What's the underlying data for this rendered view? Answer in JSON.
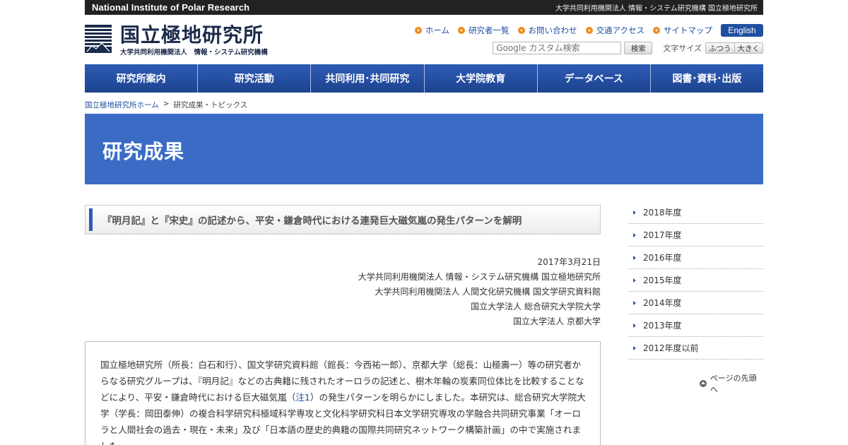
{
  "topbar": {
    "en_name": "National Institute of Polar Research",
    "jp_affiliation": "大学共同利用機関法人 情報・システム研究機構 国立極地研究所"
  },
  "logo": {
    "name": "国立極地研究所",
    "sub": "大学共同利用機関法人　情報・システム研究機構"
  },
  "utility_links": [
    {
      "label": "ホーム"
    },
    {
      "label": "研究者一覧"
    },
    {
      "label": "お問い合わせ"
    },
    {
      "label": "交通アクセス"
    },
    {
      "label": "サイトマップ"
    }
  ],
  "english_label": "English",
  "search": {
    "placeholder": "Google カスタム検索",
    "button": "検索"
  },
  "fontsize": {
    "label": "文字サイズ",
    "normal": "ふつう",
    "large": "大きく"
  },
  "gnav": [
    {
      "label": "研究所案内"
    },
    {
      "label": "研究活動"
    },
    {
      "label": "共同利用･共同研究"
    },
    {
      "label": "大学院教育"
    },
    {
      "label": "データベース"
    },
    {
      "label": "図書･資料･出版"
    }
  ],
  "breadcrumb": {
    "home": "国立極地研究所ホーム",
    "sep": ">",
    "current": "研究成果・トピックス"
  },
  "banner_title": "研究成果",
  "article": {
    "title": "『明月記』と『宋史』の記述から、平安・鎌倉時代における連発巨大磁気嵐の発生パターンを解明",
    "date": "2017年3月21日",
    "orgs": [
      "大学共同利用機関法人 情報・システム研究機構 国立極地研究所",
      "大学共同利用機関法人 人間文化研究機構 国文学研究資料館",
      "国立大学法人 総合研究大学院大学",
      "国立大学法人 京都大学"
    ],
    "body_before": "国立極地研究所（所長：白石和行）、国文学研究資料館（館長：今西祐一郎）、京都大学（総長：山極壽一）等の研究者からなる研究グループは、『明月記』などの古典籍に残されたオーロラの記述と、樹木年輪の炭素同位体比を比較することなどにより、平安・鎌倉時代における巨大磁気嵐（",
    "note_link": "注1",
    "body_after": "）の発生パターンを明らかにしました。本研究は、総合研究大学院大学（学長：岡田泰伸）の複合科学研究科極域科学専攻と文化科学研究科日本文学研究専攻の学融合共同研究事業「オーロラと人間社会の過去・現在・未来」及び「日本語の歴史的典籍の国際共同研究ネットワーク構築計画」の中で実施されました。"
  },
  "sidebar": {
    "years": [
      {
        "label": "2018年度"
      },
      {
        "label": "2017年度"
      },
      {
        "label": "2016年度"
      },
      {
        "label": "2015年度"
      },
      {
        "label": "2014年度"
      },
      {
        "label": "2013年度"
      },
      {
        "label": "2012年度以前"
      }
    ],
    "pagetop": "ページの先頭へ"
  }
}
